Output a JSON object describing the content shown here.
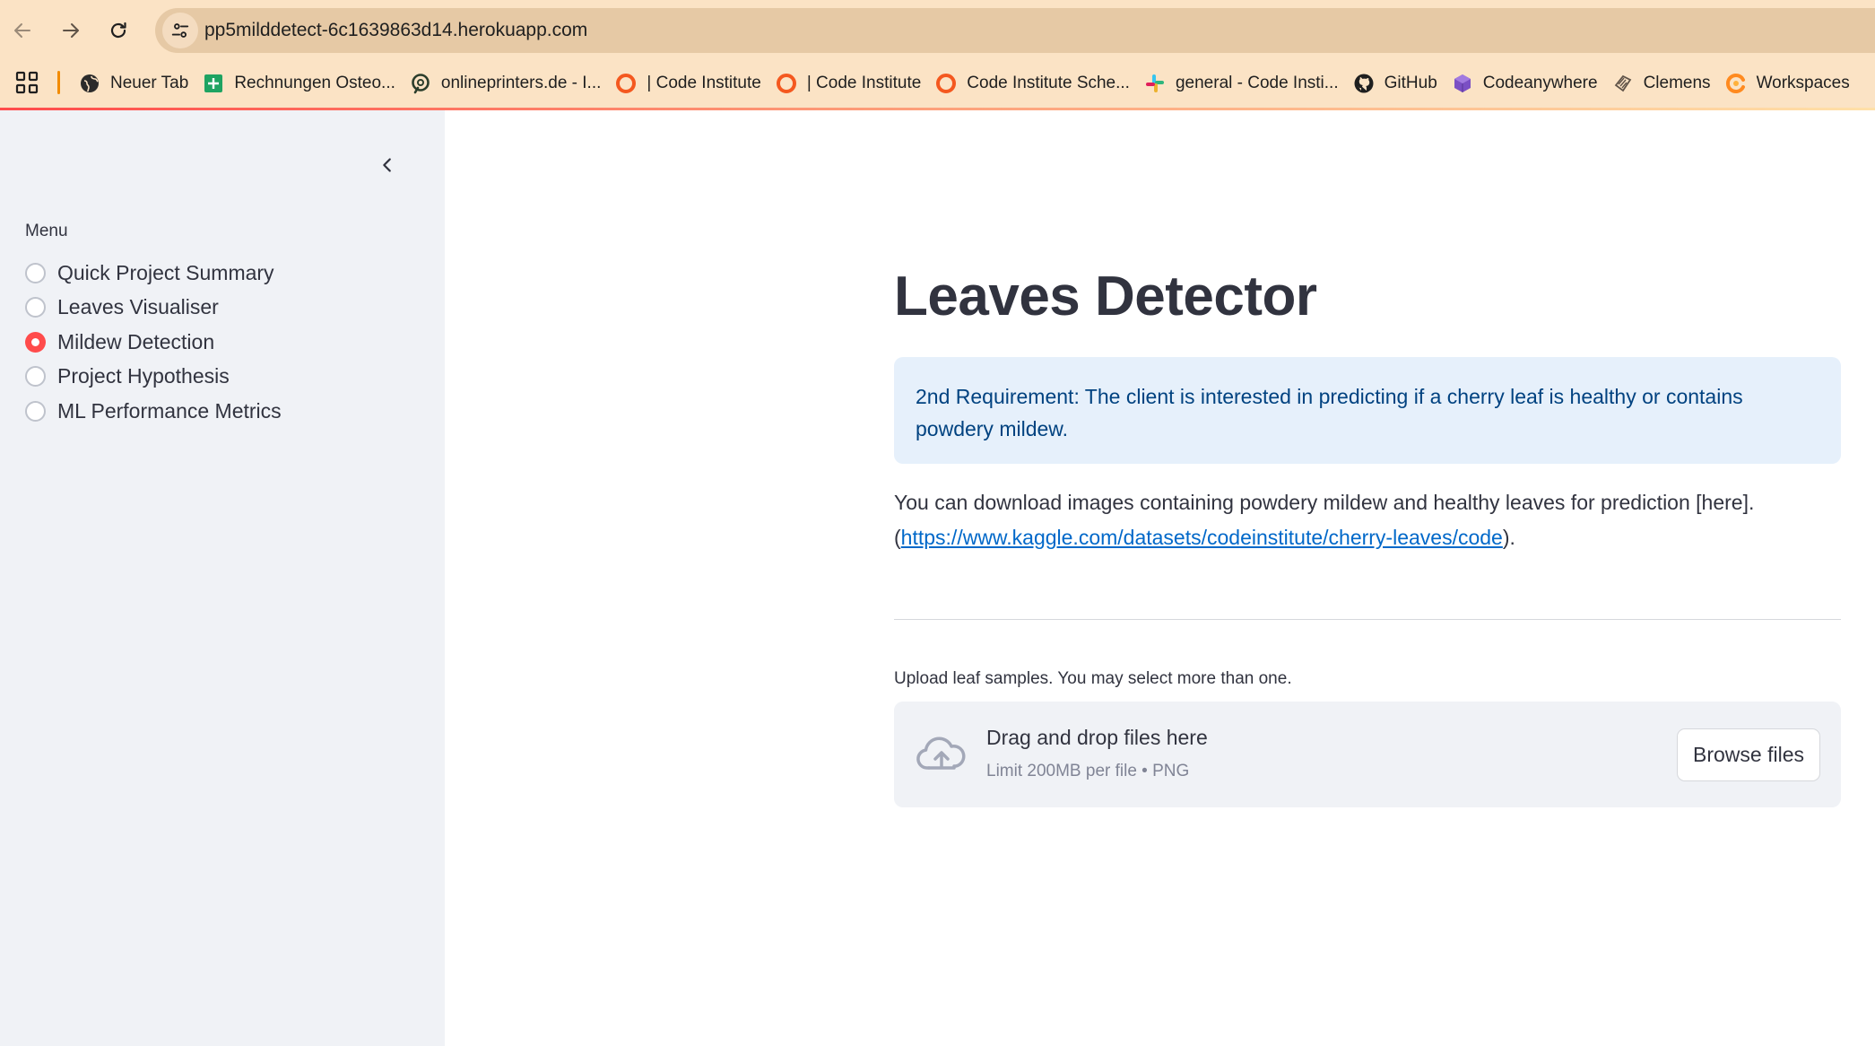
{
  "browser": {
    "url": "pp5milddetect-6c1639863d14.herokuapp.com",
    "bookmarks": [
      {
        "label": "Neuer Tab",
        "icon": "globe-icon"
      },
      {
        "label": "Rechnungen Osteo...",
        "icon": "sheets-icon"
      },
      {
        "label": "onlineprinters.de - I...",
        "icon": "onlineprinters-icon"
      },
      {
        "label": "| Code Institute",
        "icon": "code-institute-icon"
      },
      {
        "label": "| Code Institute",
        "icon": "code-institute-icon"
      },
      {
        "label": "Code Institute Sche...",
        "icon": "code-institute-icon"
      },
      {
        "label": "general - Code Insti...",
        "icon": "slack-icon"
      },
      {
        "label": "GitHub",
        "icon": "github-icon"
      },
      {
        "label": "Codeanywhere",
        "icon": "codeanywhere-icon"
      },
      {
        "label": "Clemens",
        "icon": "clemens-icon"
      },
      {
        "label": "Workspaces",
        "icon": "workspaces-icon"
      }
    ]
  },
  "sidebar": {
    "menu_label": "Menu",
    "options": [
      {
        "label": "Quick Project Summary",
        "selected": false
      },
      {
        "label": "Leaves Visualiser",
        "selected": false
      },
      {
        "label": "Mildew Detection",
        "selected": true
      },
      {
        "label": "Project Hypothesis",
        "selected": false
      },
      {
        "label": "ML Performance Metrics",
        "selected": false
      }
    ]
  },
  "main": {
    "title": "Leaves Detector",
    "info": "2nd Requirement: The client is interested in predicting if a cherry leaf is healthy or contains powdery mildew.",
    "download_text": "You can download images containing powdery mildew and healthy leaves for prediction [here].",
    "open_paren": "(",
    "link_text": "https://www.kaggle.com/datasets/codeinstitute/cherry-leaves/code",
    "close_paren": ").",
    "uploader": {
      "label": "Upload leaf samples. You may select more than one.",
      "drop_title": "Drag and drop files here",
      "drop_sub": "Limit 200MB per file • PNG",
      "browse_label": "Browse files"
    }
  },
  "colors": {
    "primary": "#ff4b4b",
    "sidebar_bg": "#f0f2f6",
    "info_bg": "#e6f0fb",
    "info_text": "#004280",
    "link": "#0068c9",
    "chrome_bg": "#fbe3c5"
  }
}
